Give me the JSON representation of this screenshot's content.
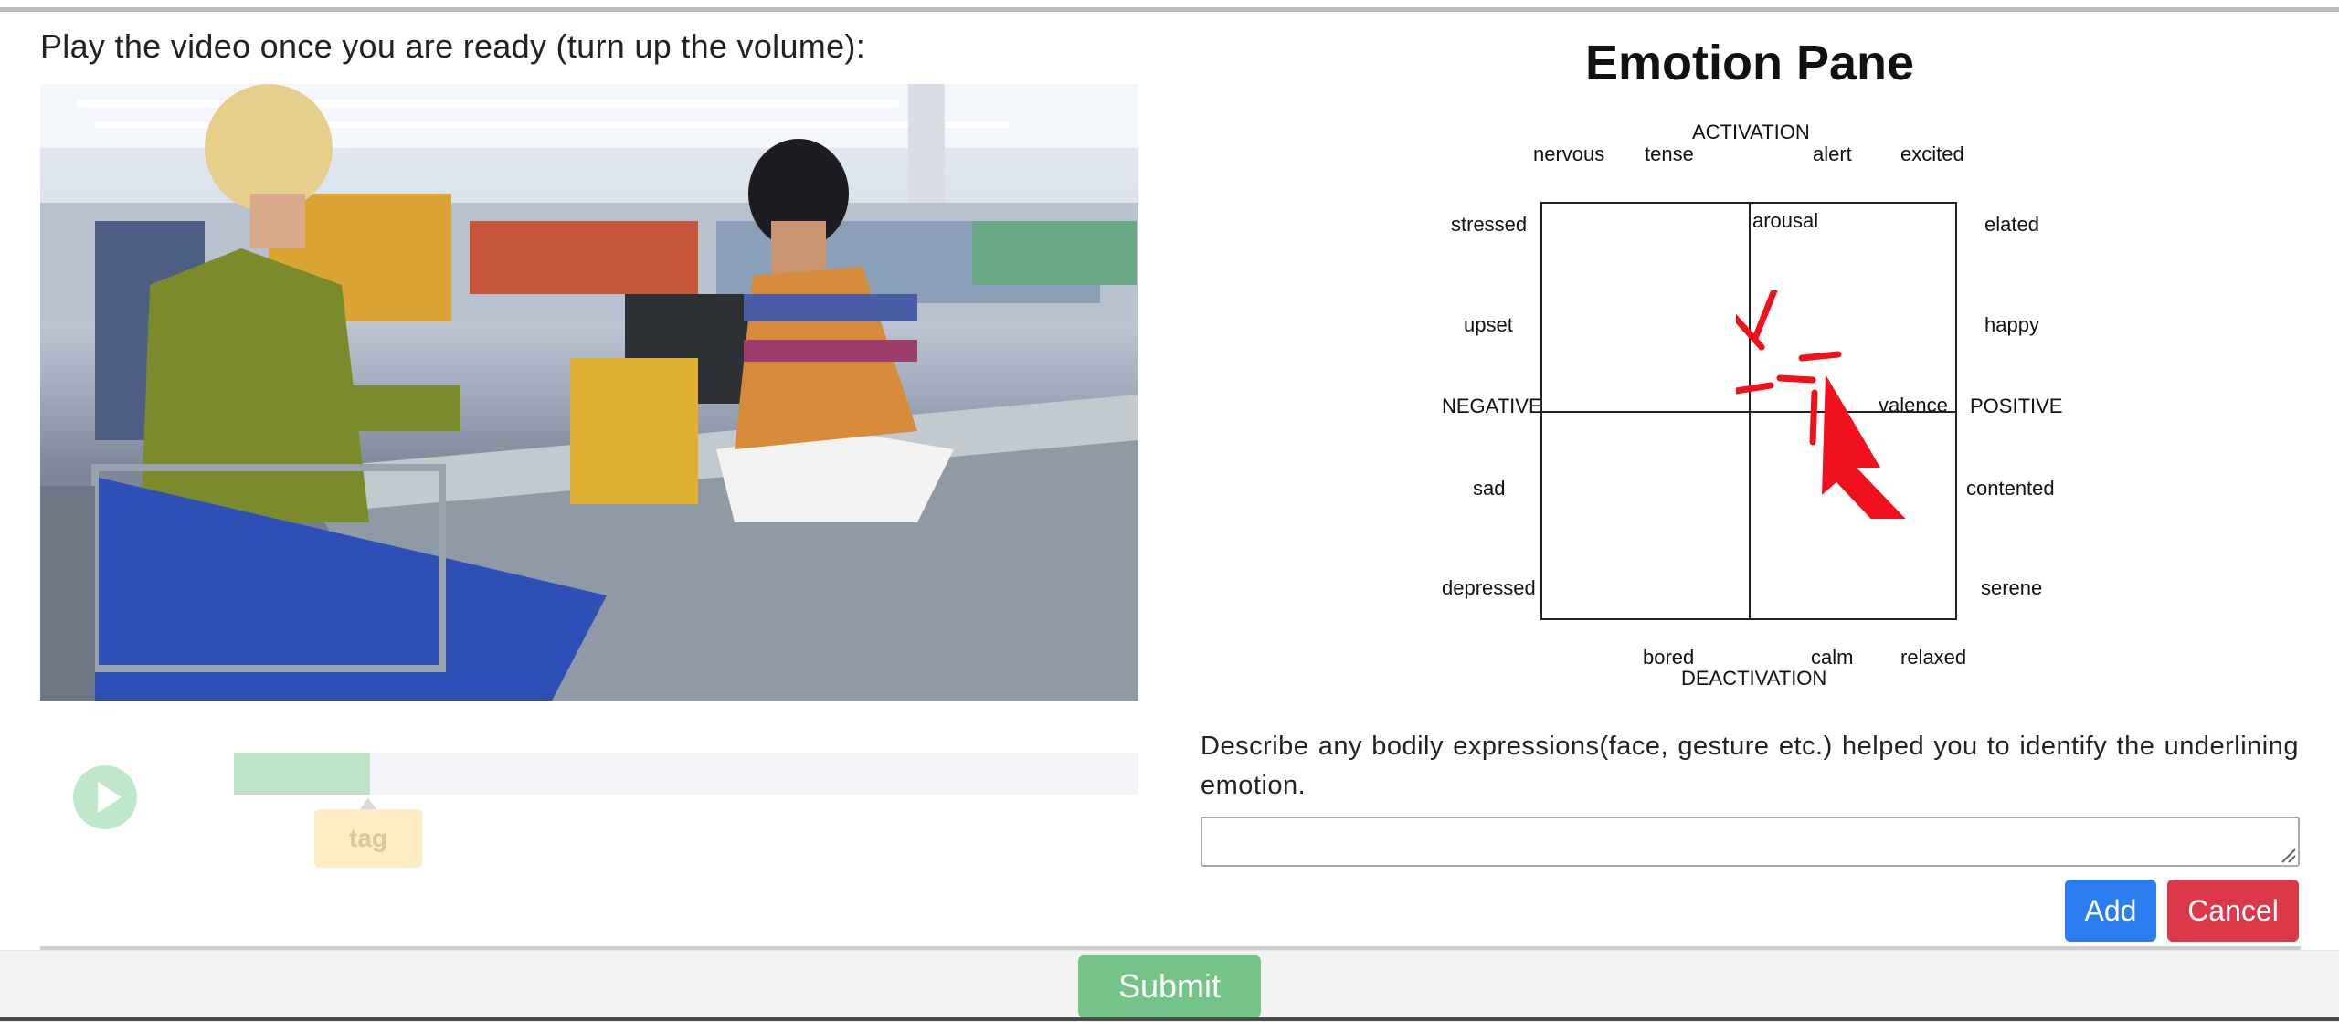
{
  "instruction": "Play the video once you are ready (turn up the volume):",
  "video": {
    "description_icon": "video-player",
    "progress_fraction": 0.15
  },
  "player": {
    "tag_label": "tag"
  },
  "emotion_pane": {
    "title": "Emotion Pane",
    "axes": {
      "top": "ACTIVATION",
      "bottom": "DEACTIVATION",
      "left": "NEGATIVE",
      "right": "POSITIVE",
      "inner_top": "arousal",
      "inner_right": "valence"
    },
    "top_labels": [
      "nervous",
      "tense",
      "alert",
      "excited"
    ],
    "left_labels": [
      "stressed",
      "upset",
      "sad",
      "depressed"
    ],
    "right_labels": [
      "elated",
      "happy",
      "contented",
      "serene"
    ],
    "bottom_labels": [
      "bored",
      "calm",
      "relaxed"
    ]
  },
  "describe": {
    "prompt": "Describe any bodily expressions(face, gesture etc.) helped you to identify the underlining emotion.",
    "value": ""
  },
  "buttons": {
    "add": "Add",
    "cancel": "Cancel",
    "submit": "Submit"
  },
  "colors": {
    "add": "#2a7cf0",
    "cancel": "#dc3848",
    "submit": "#74c48a",
    "cursor": "#f0101e"
  }
}
